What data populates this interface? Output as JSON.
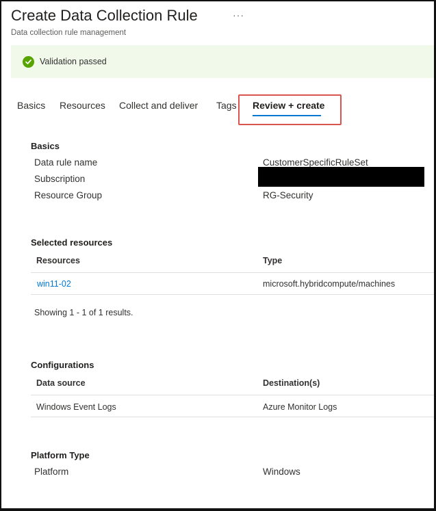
{
  "header": {
    "title": "Create Data Collection Rule",
    "more": "···",
    "subtitle": "Data collection rule management"
  },
  "banner": {
    "status": "success",
    "icon": "checkmark-circle-icon",
    "text": "Validation passed",
    "color": "#57a300",
    "background": "#f0f9ea"
  },
  "tabs": {
    "active": "Review + create",
    "items": [
      {
        "label": "Basics"
      },
      {
        "label": "Resources"
      },
      {
        "label": "Collect and deliver"
      },
      {
        "label": "Tags"
      },
      {
        "label": "Review + create"
      }
    ]
  },
  "basics": {
    "title": "Basics",
    "rows": [
      {
        "label": "Data rule name",
        "value": "CustomerSpecificRuleSet"
      },
      {
        "label": "Subscription",
        "value": ""
      },
      {
        "label": "Resource Group",
        "value": "RG-Security"
      }
    ]
  },
  "resources": {
    "title": "Selected resources",
    "columns": [
      "Resources",
      "Type"
    ],
    "rows": [
      {
        "resource": "win11-02",
        "type": "microsoft.hybridcompute/machines"
      }
    ],
    "footer": "Showing 1 - 1 of 1 results."
  },
  "configurations": {
    "title": "Configurations",
    "columns": [
      "Data source",
      "Destination(s)"
    ],
    "rows": [
      {
        "source": "Windows Event Logs",
        "destination": "Azure Monitor Logs"
      }
    ]
  },
  "platform": {
    "title": "Platform Type",
    "label": "Platform",
    "value": "Windows"
  },
  "colors": {
    "accent": "#0078d4",
    "highlight_box": "#d9534f"
  }
}
